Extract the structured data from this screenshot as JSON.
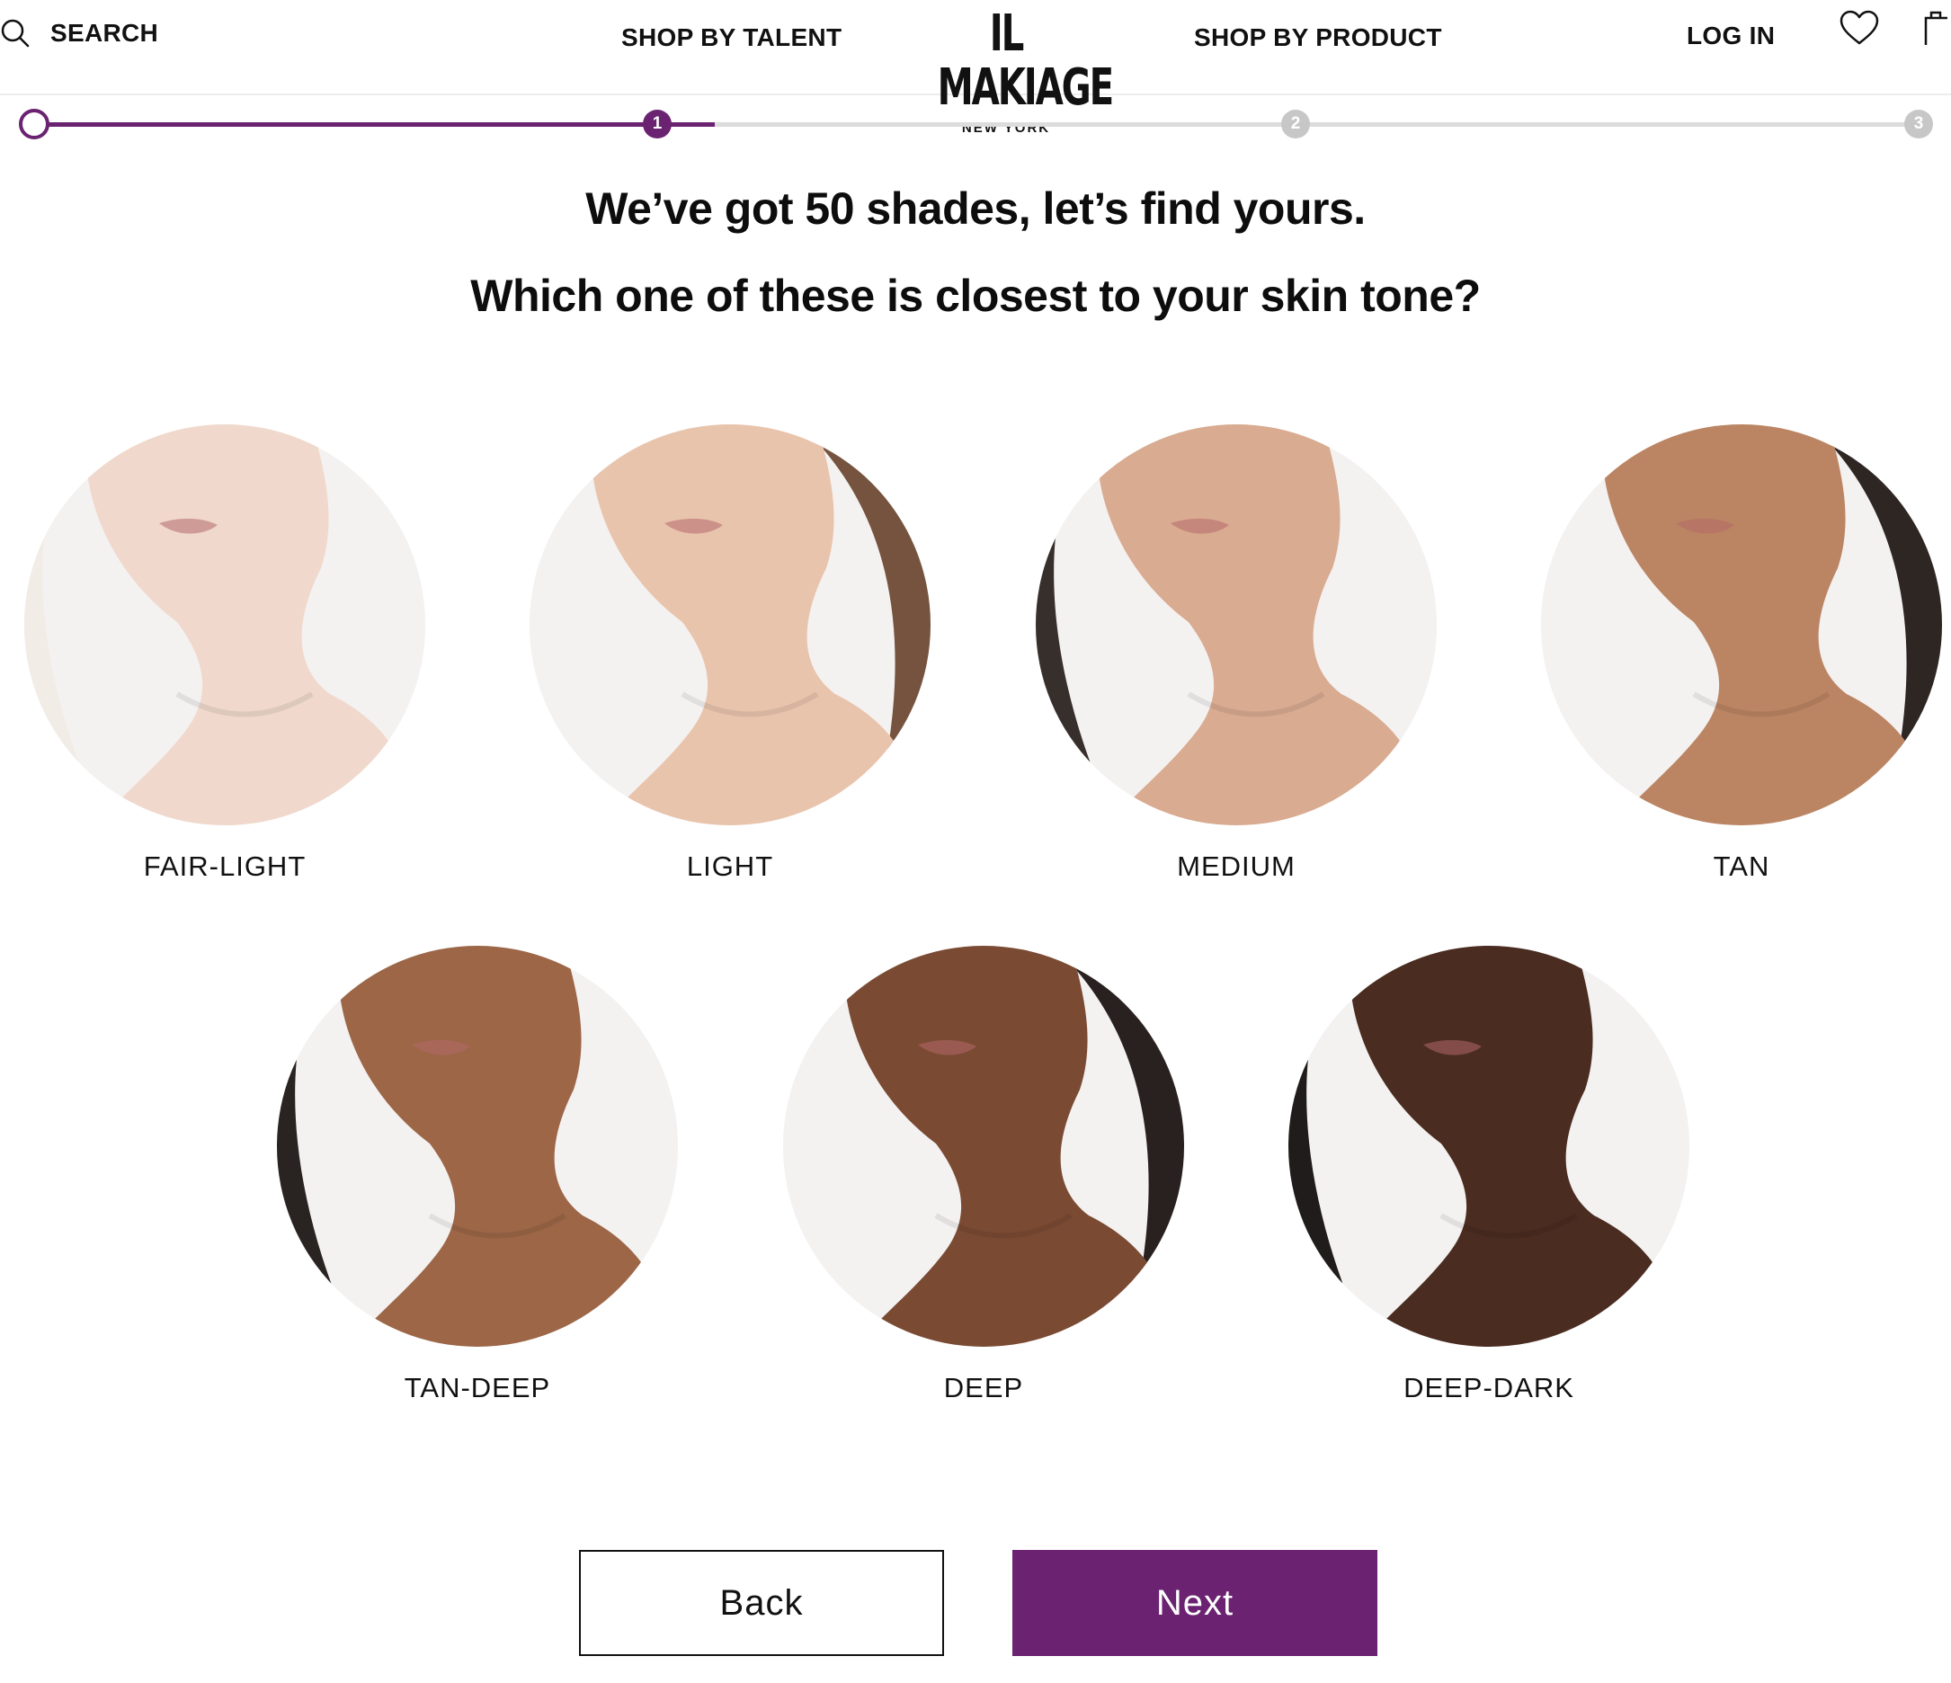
{
  "header": {
    "search_label": "SEARCH",
    "nav_talent": "SHOP BY TALENT",
    "nav_product": "SHOP BY PRODUCT",
    "logo_main": "IL MAKIAGE",
    "logo_sub": "NEW YORK",
    "login_label": "LOG IN",
    "icons": [
      "search-icon",
      "heart-icon",
      "bag-icon"
    ]
  },
  "progress": {
    "steps": [
      "1",
      "2",
      "3"
    ],
    "current_step": 1,
    "accent_color": "#6a2271",
    "inactive_color": "#c7c7c7"
  },
  "headline": "We’ve got 50 shades, let’s find yours.",
  "question": "Which one of these is closest to your skin tone?",
  "tones": [
    {
      "label": "FAIR-LIGHT",
      "skin": "#f0d9cc",
      "hair": "#f1ebe6",
      "bg": "#f4f1f1"
    },
    {
      "label": "LIGHT",
      "skin": "#e9c4ad",
      "hair": "#6e4a35",
      "bg": "#f4f1f1"
    },
    {
      "label": "MEDIUM",
      "skin": "#d9ab91",
      "hair": "#2c2421",
      "bg": "#f4f1f1"
    },
    {
      "label": "TAN",
      "skin": "#bb8563",
      "hair": "#221a17",
      "bg": "#f4f1f1"
    },
    {
      "label": "TAN-DEEP",
      "skin": "#9c6647",
      "hair": "#1e1715",
      "bg": "#f4f1f1"
    },
    {
      "label": "DEEP",
      "skin": "#7a4a33",
      "hair": "#1c1513",
      "bg": "#f4f1f1"
    },
    {
      "label": "DEEP-DARK",
      "skin": "#4a2c20",
      "hair": "#141010",
      "bg": "#f4f1f1"
    }
  ],
  "buttons": {
    "back": "Back",
    "next": "Next"
  }
}
